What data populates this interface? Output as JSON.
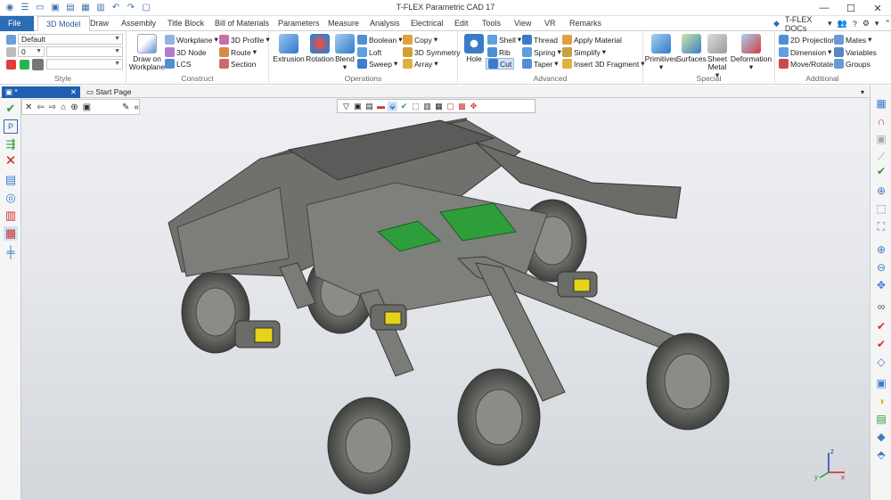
{
  "app": {
    "title": "T-FLEX Parametric CAD 17",
    "docs_label": "T-FLEX DOCs"
  },
  "ribbon_tabs": [
    "File",
    "3D Model",
    "Draw",
    "Assembly",
    "Title Block",
    "Bill of Materials",
    "Parameters",
    "Measure",
    "Analysis",
    "Electrical",
    "Edit",
    "Tools",
    "View",
    "VR",
    "Remarks"
  ],
  "style_group": {
    "label": "Style",
    "layer": "Default",
    "level": "0"
  },
  "construct_group": {
    "label": "Construct",
    "draw_on_workplane": "Draw on Workplane",
    "workplane": "Workplane",
    "node3d": "3D Node",
    "lcs": "LCS",
    "profile3d": "3D Profile",
    "route": "Route",
    "section": "Section"
  },
  "operations_group": {
    "label": "Operations",
    "extrusion": "Extrusion",
    "rotation": "Rotation",
    "blend": "Blend",
    "boolean": "Boolean",
    "loft": "Loft",
    "sweep": "Sweep",
    "copy": "Copy",
    "symmetry3d": "3D Symmetry",
    "array": "Array"
  },
  "advanced_group": {
    "label": "Advanced",
    "hole": "Hole",
    "shell": "Shell",
    "rib": "Rib",
    "cut": "Cut",
    "thread": "Thread",
    "spring": "Spring",
    "taper": "Taper",
    "apply_material": "Apply Material",
    "simplify": "Simplify",
    "insert_fragment": "Insert 3D Fragment"
  },
  "special_group": {
    "label": "Special",
    "primitives": "Primitives",
    "surfaces": "Surfaces",
    "sheet_metal": "Sheet Metal",
    "deformation": "Deformation"
  },
  "additional_group": {
    "label": "Additional",
    "projection2d": "2D Projection",
    "dimension": "Dimension",
    "move_rotate": "Move/Rotate",
    "mates": "Mates",
    "variables": "Variables",
    "groups": "Groups"
  },
  "document_tabs": {
    "active": "*",
    "start_page": "Start Page"
  },
  "axis_labels": {
    "z": "z",
    "x": "x",
    "y": "y"
  },
  "colors": {
    "accent": "#2b6cb5",
    "green_board": "#2e9e3a",
    "yellow": "#e6d31a",
    "body": "#7a7c78"
  }
}
